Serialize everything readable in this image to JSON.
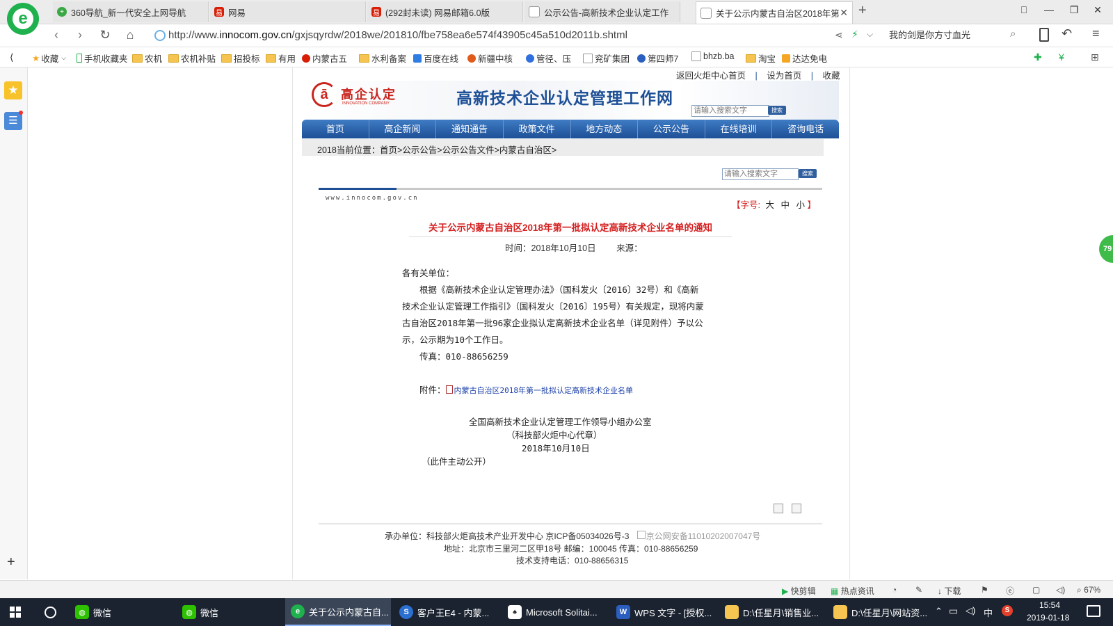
{
  "browser": {
    "tabs": [
      {
        "title": "360导航_新一代安全上网导航"
      },
      {
        "title": "网易"
      },
      {
        "title": "(292封未读) 网易邮箱6.0版"
      },
      {
        "title": "公示公告-高新技术企业认定工作"
      },
      {
        "title": "关于公示内蒙古自治区2018年第",
        "active": true
      }
    ],
    "new_tab": "+",
    "url_prefix": "http://www.",
    "url_domain": "innocom.gov.cn",
    "url_path": "/gxjsqyrdw/2018we/201810/fbe758ea6e574f43905c45a510d2011b.shtml",
    "search_text": "我的剑是你方寸血光"
  },
  "bookmarks": [
    "收藏",
    "手机收藏夹",
    "农机",
    "农机补贴",
    "招投标",
    "有用",
    "内蒙古五",
    "水利备案",
    "百度在线",
    "新疆中核",
    "管径、压",
    "兖矿集团",
    "第四师7",
    "bhzb.ba",
    "淘宝",
    "达达免电"
  ],
  "site": {
    "top_links": [
      "返回火炬中心首页",
      "设为首页",
      "收藏"
    ],
    "logo_cn": "高企认定",
    "logo_en": "INNOVATION COMPANY",
    "site_title": "高新技术企业认定管理工作网",
    "search_placeholder": "请输入搜索文字",
    "search_go": "搜索",
    "menu": [
      "首页",
      "高企新闻",
      "通知通告",
      "政策文件",
      "地方动态",
      "公示公告",
      "在线培训",
      "咨询电话"
    ],
    "breadcrumb_prefix": "2018当前位置：",
    "breadcrumb": "首页>公示公告>公示公告文件>内蒙古自治区>"
  },
  "article": {
    "site_url": "www.innocom.gov.cn",
    "font_size_label": "【字号:",
    "font_sizes": [
      "大",
      "中",
      "小"
    ],
    "font_size_end": "】",
    "title": "关于公示内蒙古自治区2018年第一批拟认定高新技术企业名单的通知",
    "meta_time": "时间：2018年10月10日",
    "meta_source": "来源：",
    "salutation": "各有关单位：",
    "body_lines": [
      "　　根据《高新技术企业认定管理办法》（国科发火〔2016〕32号）和《高新",
      "技术企业认定管理工作指引》（国科发火〔2016〕195号）有关规定，现将内蒙",
      "古自治区2018年第一批96家企业拟认定高新技术企业名单（详见附件）予以公",
      "示，公示期为10个工作日。"
    ],
    "fax": "　　传真：010-88656259",
    "attachment_label": "　　附件：",
    "attachment_link": "内蒙古自治区2018年第一批拟认定高新技术企业名单",
    "signature": "全国高新技术企业认定管理工作领导小组办公室",
    "signature_note": "（科技部火炬中心代章）",
    "date": "2018年10月10日",
    "public_note": "（此件主动公开）"
  },
  "footer": {
    "line1": "承办单位：科技部火炬高技术产业开发中心 京ICP备05034026号-3",
    "badge": "京公网安备11010202007047号",
    "line2": "地址：北京市三里河二区甲18号 邮编：100045 传真：010-88656259",
    "line3": "技术支持电话：010-88656315"
  },
  "statusbar": {
    "items": [
      "快剪辑",
      "热点资讯",
      "下载"
    ],
    "zoom": "67%"
  },
  "sidebar_badge": "79",
  "taskbar": {
    "apps": [
      {
        "label": "微信"
      },
      {
        "label": "微信"
      },
      {
        "label": "关于公示内蒙古自...",
        "active": true
      },
      {
        "label": "客户王E4 - 内蒙..."
      },
      {
        "label": "Microsoft Solitai..."
      },
      {
        "label": "WPS 文字 - [授权..."
      },
      {
        "label": "D:\\任星月\\销售业..."
      },
      {
        "label": "D:\\任星月\\网站资..."
      }
    ],
    "ime": "中",
    "time": "15:54",
    "date": "2019-01-18"
  },
  "colors": {
    "menu_blue": "#1d4f96",
    "title_red": "#d42020",
    "link_blue": "#1a3fa8",
    "logo_red": "#c8241c",
    "taskbar": "#1b2330"
  }
}
